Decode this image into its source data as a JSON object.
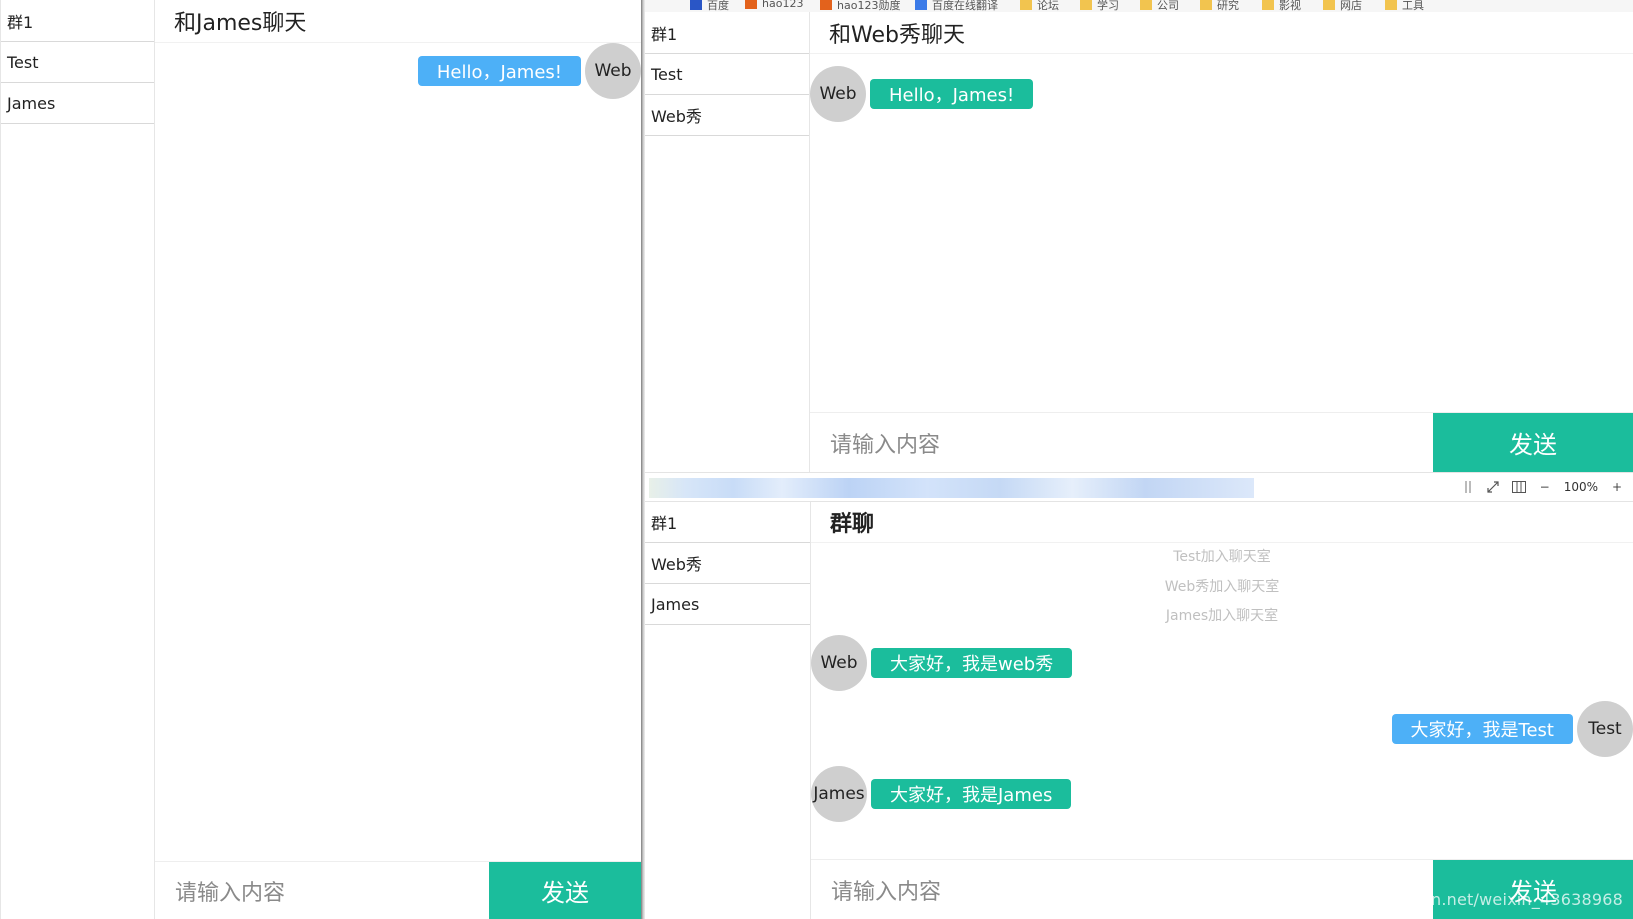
{
  "left_window": {
    "sidebar": [
      "群1",
      "Test",
      "James"
    ],
    "title": "和James聊天",
    "messages": [
      {
        "from": "Web",
        "text": "Hello，James!",
        "side": "right",
        "color": "#4db0f7"
      }
    ],
    "input_placeholder": "请输入内容",
    "send_label": "发送"
  },
  "top_right_window": {
    "sidebar": [
      "群1",
      "Test",
      "Web秀"
    ],
    "title": "和Web秀聊天",
    "messages": [
      {
        "from": "Web",
        "text": "Hello，James!",
        "side": "left",
        "color": "#1bbd9c"
      }
    ],
    "input_placeholder": "请输入内容",
    "send_label": "发送"
  },
  "bottom_right_window": {
    "sidebar": [
      "群1",
      "Web秀",
      "James"
    ],
    "title": "群聊",
    "system_messages": [
      "Test加入聊天室",
      "Web秀加入聊天室",
      "James加入聊天室"
    ],
    "messages": [
      {
        "from": "Web",
        "text": "大家好，我是web秀",
        "side": "left",
        "color": "#1bbd9c"
      },
      {
        "from": "Test",
        "text": "大家好，我是Test",
        "side": "right",
        "color": "#4db0f7"
      },
      {
        "from": "James",
        "text": "大家好，我是James",
        "side": "left",
        "color": "#1bbd9c"
      }
    ],
    "input_placeholder": "请输入内容",
    "send_label": "发送"
  },
  "browser_bookmarks": [
    "百度",
    "hao123",
    "hao123勋度",
    "百度在线翻译",
    "论坛",
    "学习",
    "公司",
    "研究",
    "影视",
    "网店",
    "工具"
  ],
  "zoom": {
    "level": "100%",
    "minus": "−",
    "plus": "+"
  },
  "watermark": "https://blog.csdn.net/weixin_43638968",
  "colors": {
    "teal": "#1bbd9c",
    "blue": "#4db0f7",
    "avatar": "#cfcfcf"
  }
}
